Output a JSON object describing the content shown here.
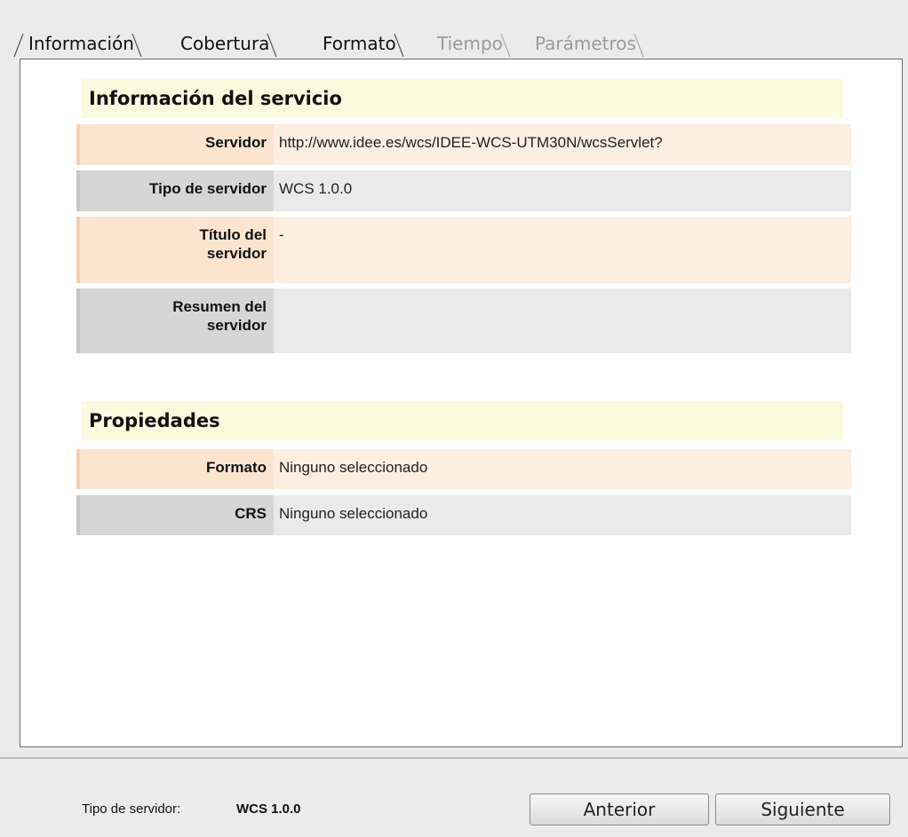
{
  "tabs": [
    {
      "label": "Información",
      "state": "active"
    },
    {
      "label": "Cobertura",
      "state": "enabled"
    },
    {
      "label": "Formato",
      "state": "enabled"
    },
    {
      "label": "Tiempo",
      "state": "disabled"
    },
    {
      "label": "Parámetros",
      "state": "disabled"
    }
  ],
  "service_info": {
    "title": "Información del servicio",
    "rows": [
      {
        "label": "Servidor",
        "value": "http://www.idee.es/wcs/IDEE-WCS-UTM30N/wcsServlet?"
      },
      {
        "label": "Tipo de servidor",
        "value": "WCS 1.0.0"
      },
      {
        "label_line1": "Título del",
        "label_line2": "servidor",
        "value": "-"
      },
      {
        "label_line1": "Resumen del",
        "label_line2": "servidor",
        "value": ""
      }
    ]
  },
  "properties": {
    "title": "Propiedades",
    "rows": [
      {
        "label": "Formato",
        "value": "Ninguno seleccionado"
      },
      {
        "label": "CRS",
        "value": "Ninguno seleccionado"
      }
    ]
  },
  "footer": {
    "server_type_label": "Tipo de servidor:",
    "server_type_value": "WCS 1.0.0",
    "previous_button": "Anterior",
    "next_button": "Siguiente"
  },
  "colors": {
    "header_bg": "#fafade",
    "row_peach": "#fdeee2",
    "row_grey": "#eaeaea",
    "disabled_tab": "#9a9a9a"
  }
}
